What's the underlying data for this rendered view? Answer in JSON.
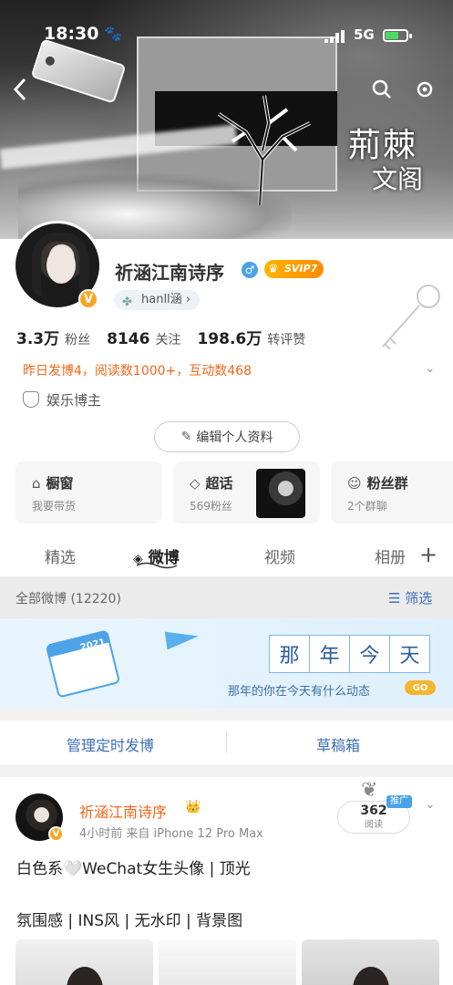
{
  "status": {
    "time": "18:30",
    "network": "5G"
  },
  "cover": {
    "title_big": "荊棘",
    "title_small": "文阁"
  },
  "profile": {
    "nickname": "祈涵江南诗序",
    "vip": "SVIP7",
    "handle": "hanll涵",
    "stats": [
      {
        "num": "3.3万",
        "label": "粉丝"
      },
      {
        "num": "8146",
        "label": "关注"
      },
      {
        "num": "198.6万",
        "label": "转评赞"
      }
    ],
    "daily": "昨日发博4，阅读数1000+，互动数468",
    "tagline": "娱乐博主",
    "edit_label": "编辑个人资料"
  },
  "cards": [
    {
      "title": "橱窗",
      "sub": "我要带货",
      "icon": "shop-icon"
    },
    {
      "title": "超话",
      "sub": "569粉丝",
      "icon": "diamond-icon"
    },
    {
      "title": "粉丝群",
      "sub": "2个群聊",
      "icon": "group-icon"
    }
  ],
  "tabs": [
    "精选",
    "微博",
    "视频",
    "相册"
  ],
  "filter": {
    "label": "全部微博 (12220)",
    "button": "筛选"
  },
  "banner": {
    "chars": [
      "那",
      "年",
      "今",
      "天"
    ],
    "sub": "那年的你在今天有什么动态",
    "go": "GO",
    "cal_year": "2021"
  },
  "actions": {
    "schedule": "管理定时发博",
    "drafts": "草稿箱"
  },
  "post": {
    "name": "祈涵江南诗序",
    "meta": "4小时前  来自 iPhone 12 Pro Max",
    "reads": "362",
    "reads_label": "阅读",
    "promo": "推广",
    "line1": "白色系🤍WeChat女生头像 | 顶光",
    "line2": "氛围感 | INS风 | 无水印 | 背景图"
  }
}
